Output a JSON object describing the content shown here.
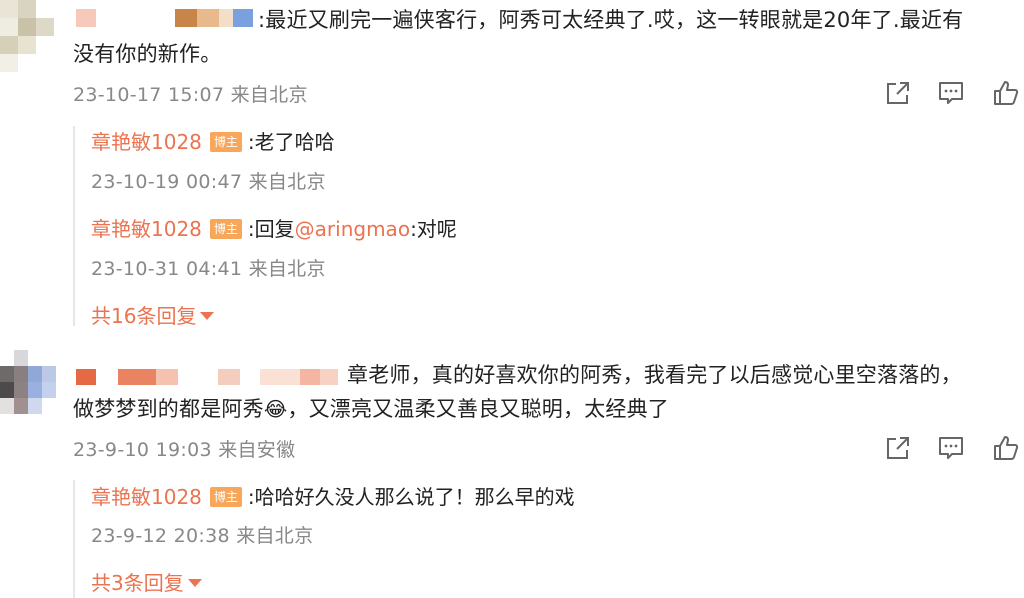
{
  "comments": [
    {
      "text_line1": ":最近又刷完一遍侠客行，阿秀可太经典了.哎，这一转眼就是20年了.最近有",
      "text_line2": "没有你的新作。",
      "meta": "23-10-17 15:07 来自北京",
      "replies": [
        {
          "name": "章艳敏1028",
          "badge": "博主",
          "text": ":老了哈哈",
          "meta": "23-10-19 00:47 来自北京"
        },
        {
          "name": "章艳敏1028",
          "badge": "博主",
          "text_prefix": ":回复",
          "mention": "@aringmao",
          "text_suffix": ":对呢",
          "meta": "23-10-31 04:41 来自北京"
        }
      ],
      "more_replies": "共16条回复"
    },
    {
      "text_line1": "章老师，真的好喜欢你的阿秀，我看完了以后感觉心里空落落的，",
      "text_line2a": "做梦梦到的都是阿秀",
      "text_line2b": "，又漂亮又温柔又善良又聪明，太经典了",
      "emoji": "😂",
      "meta": "23-9-10 19:03 来自安徽",
      "replies": [
        {
          "name": "章艳敏1028",
          "badge": "博主",
          "text": ":哈哈好久没人那么说了！那么早的戏",
          "meta": "23-9-12 20:38 来自北京"
        }
      ],
      "more_replies": "共3条回复"
    }
  ],
  "actions": [
    "share-icon",
    "comment-icon",
    "like-icon"
  ],
  "colors": {
    "accent": "#eb7350",
    "badge": "#f7a65a",
    "meta": "#888888"
  }
}
